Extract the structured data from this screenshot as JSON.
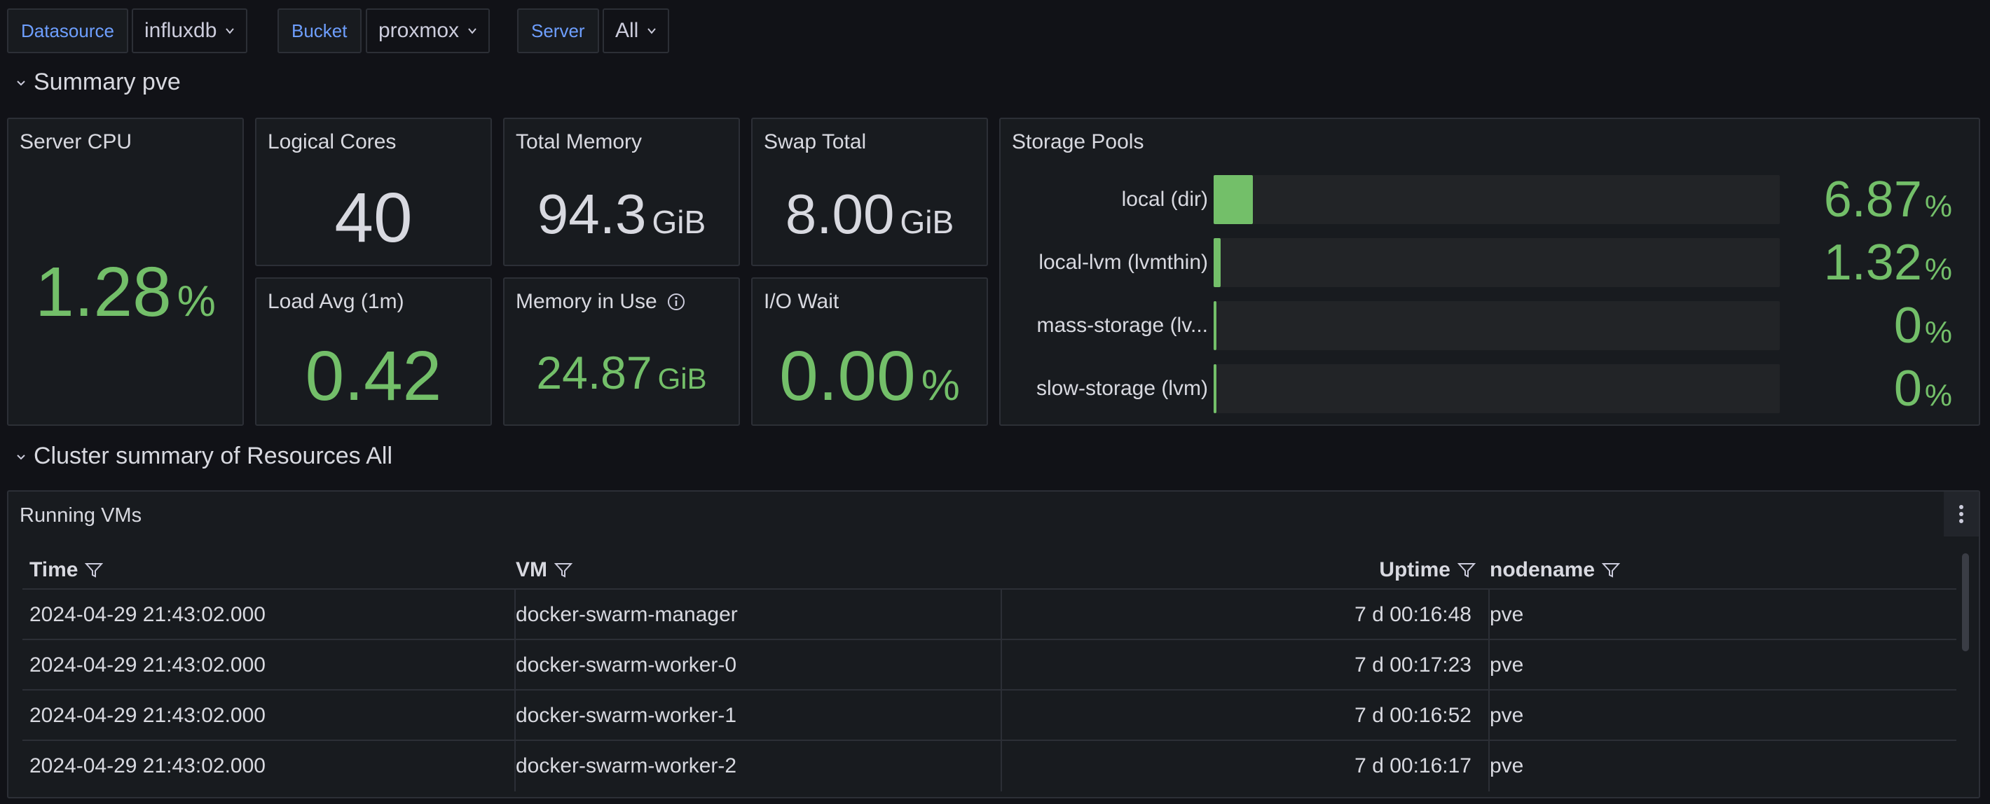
{
  "variables": {
    "datasource": {
      "label": "Datasource",
      "value": "influxdb"
    },
    "bucket": {
      "label": "Bucket",
      "value": "proxmox"
    },
    "server": {
      "label": "Server",
      "value": "All"
    }
  },
  "rows": {
    "summary": "Summary pve",
    "cluster": "Cluster summary of Resources All"
  },
  "stats": {
    "server_cpu": {
      "title": "Server CPU",
      "value": "1.28",
      "unit": "%"
    },
    "logical_cores": {
      "title": "Logical Cores",
      "value": "40"
    },
    "total_memory": {
      "title": "Total Memory",
      "value": "94.3",
      "unit": "GiB"
    },
    "swap_total": {
      "title": "Swap Total",
      "value": "8.00",
      "unit": "GiB"
    },
    "load_avg": {
      "title": "Load Avg (1m)",
      "value": "0.42"
    },
    "memory_in_use": {
      "title": "Memory in Use",
      "value": "24.87",
      "unit": "GiB"
    },
    "io_wait": {
      "title": "I/O Wait",
      "value": "0.00",
      "unit": "%"
    }
  },
  "storage": {
    "title": "Storage Pools",
    "pools": [
      {
        "name": "local (dir)",
        "value": "6.87",
        "unit": "%",
        "percent": 6.87
      },
      {
        "name": "local-lvm (lvmthin)",
        "value": "1.32",
        "unit": "%",
        "percent": 1.32
      },
      {
        "name": "mass-storage (lv...",
        "value": "0",
        "unit": "%",
        "percent": 0
      },
      {
        "name": "slow-storage (lvm)",
        "value": "0",
        "unit": "%",
        "percent": 0
      }
    ]
  },
  "vms": {
    "title": "Running VMs",
    "columns": [
      "Time",
      "VM",
      "Uptime",
      "nodename"
    ],
    "rows": [
      [
        "2024-04-29 21:43:02.000",
        "docker-swarm-manager",
        "7 d 00:16:48",
        "pve"
      ],
      [
        "2024-04-29 21:43:02.000",
        "docker-swarm-worker-0",
        "7 d 00:17:23",
        "pve"
      ],
      [
        "2024-04-29 21:43:02.000",
        "docker-swarm-worker-1",
        "7 d 00:16:52",
        "pve"
      ],
      [
        "2024-04-29 21:43:02.000",
        "docker-swarm-worker-2",
        "7 d 00:16:17",
        "pve"
      ]
    ]
  },
  "colors": {
    "accent": "#6e9fff",
    "value_green": "#73bf69",
    "panel_bg": "#181b1f",
    "page_bg": "#111217"
  }
}
